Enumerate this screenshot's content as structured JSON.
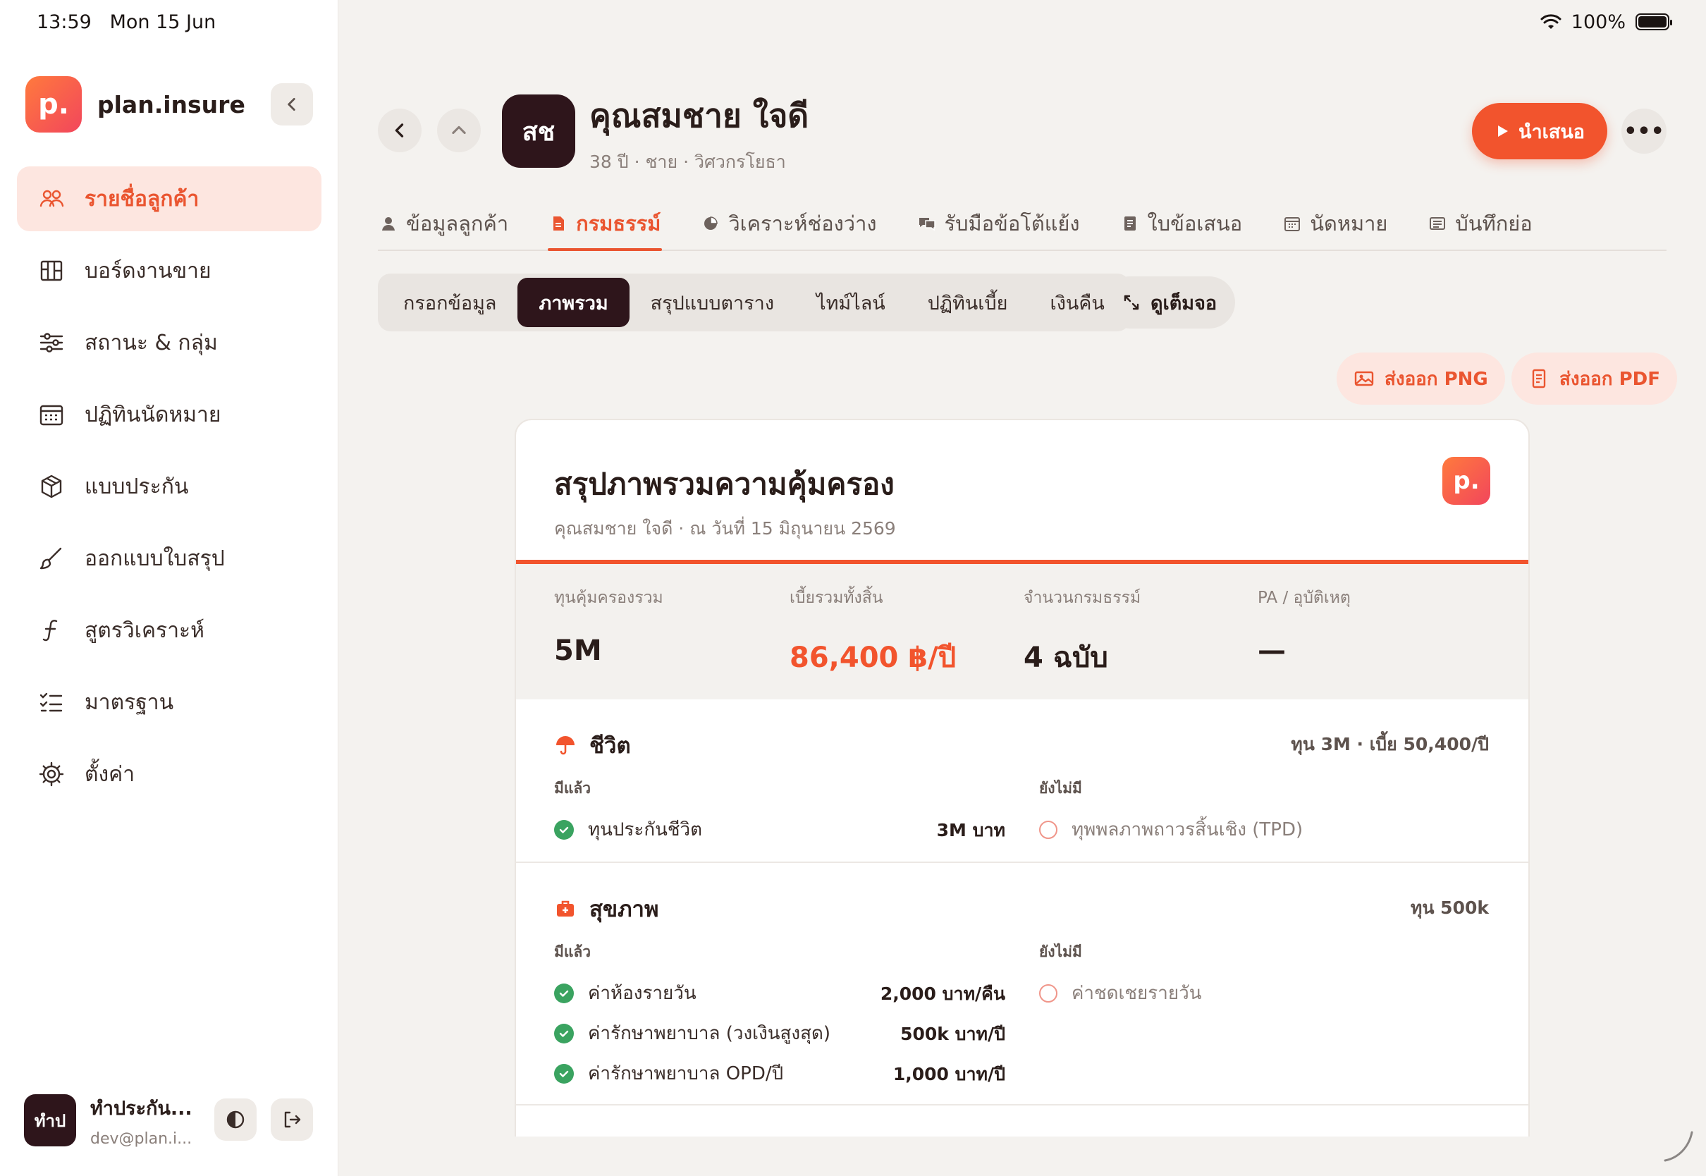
{
  "status": {
    "time": "13:59",
    "date": "Mon 15 Jun",
    "battery": "100%"
  },
  "sidebar": {
    "brand_logo": "p.",
    "brand_name": "plan.insure",
    "items": [
      {
        "label": "รายชื่อลูกค้า",
        "icon": "users-icon",
        "active": true
      },
      {
        "label": "บอร์ดงานขาย",
        "icon": "board-icon"
      },
      {
        "label": "สถานะ & กลุ่ม",
        "icon": "sliders-icon"
      },
      {
        "label": "ปฏิทินนัดหมาย",
        "icon": "calendar-icon"
      },
      {
        "label": "แบบประกัน",
        "icon": "box-icon"
      },
      {
        "label": "ออกแบบใบสรุป",
        "icon": "brush-icon"
      },
      {
        "label": "สูตรวิเคราะห์",
        "icon": "function-icon"
      },
      {
        "label": "มาตรฐาน",
        "icon": "checklist-icon"
      },
      {
        "label": "ตั้งค่า",
        "icon": "gear-icon"
      }
    ],
    "user": {
      "avatar": "ทำป",
      "name": "ทำประกัน...",
      "email": "dev@plan.i..."
    }
  },
  "header": {
    "avatar": "สช",
    "name": "คุณสมชาย ใจดี",
    "meta": "38 ปี · ชาย · วิศวกรโยธา",
    "present_label": "นำเสนอ",
    "more_label": "•••"
  },
  "tabs": [
    {
      "label": "ข้อมูลลูกค้า",
      "icon": "person-icon"
    },
    {
      "label": "กรมธรรม์",
      "icon": "document-icon",
      "active": true
    },
    {
      "label": "วิเคราะห์ช่องว่าง",
      "icon": "pie-icon"
    },
    {
      "label": "รับมือข้อโต้แย้ง",
      "icon": "chat-icon"
    },
    {
      "label": "ใบข้อเสนอ",
      "icon": "file-icon"
    },
    {
      "label": "นัดหมาย",
      "icon": "calendar-icon"
    },
    {
      "label": "บันทึกย่อ",
      "icon": "note-icon"
    }
  ],
  "subtabs": [
    {
      "label": "กรอกข้อมูล"
    },
    {
      "label": "ภาพรวม",
      "active": true
    },
    {
      "label": "สรุปแบบตาราง"
    },
    {
      "label": "ไทม์ไลน์"
    },
    {
      "label": "ปฏิทินเบี้ย"
    },
    {
      "label": "เงินคืน"
    }
  ],
  "fullscreen_label": "ดูเต็มจอ",
  "export": {
    "png": "ส่งออก PNG",
    "pdf": "ส่งออก PDF"
  },
  "card": {
    "title": "สรุปภาพรวมความคุ้มครอง",
    "subtitle": "คุณสมชาย ใจดี · ณ วันที่ 15 มิถุนายน 2569",
    "logo": "p.",
    "stats": [
      {
        "label": "ทุนคุ้มครองรวม",
        "value": "5M"
      },
      {
        "label": "เบี้ยรวมทั้งสิ้น",
        "value": "86,400 ฿/ปี",
        "accent": true
      },
      {
        "label": "จำนวนกรมธรรม์",
        "value": "4 ฉบับ"
      },
      {
        "label": "PA / อุบัติเหตุ",
        "value": "—"
      }
    ],
    "sections": [
      {
        "title": "ชีวิต",
        "icon": "umbrella-icon",
        "summary": "ทุน 3M · เบี้ย 50,400/ปี",
        "have_label": "มีแล้ว",
        "missing_label": "ยังไม่มี",
        "have": [
          {
            "label": "ทุนประกันชีวิต",
            "value": "3M บาท"
          }
        ],
        "missing": [
          {
            "label": "ทุพพลภาพถาวรสิ้นเชิง (TPD)"
          }
        ]
      },
      {
        "title": "สุขภาพ",
        "icon": "medkit-icon",
        "summary": "ทุน 500k",
        "have_label": "มีแล้ว",
        "missing_label": "ยังไม่มี",
        "have": [
          {
            "label": "ค่าห้องรายวัน",
            "value": "2,000 บาท/คืน"
          },
          {
            "label": "ค่ารักษาพยาบาล (วงเงินสูงสุด)",
            "value": "500k บาท/ปี"
          },
          {
            "label": "ค่ารักษาพยาบาล OPD/ปี",
            "value": "1,000 บาท/ปี"
          }
        ],
        "missing": [
          {
            "label": "ค่าชดเชยรายวัน"
          }
        ]
      }
    ]
  },
  "colors": {
    "accent": "#f2542d",
    "dark": "#2e151b",
    "success": "#3aa360"
  }
}
